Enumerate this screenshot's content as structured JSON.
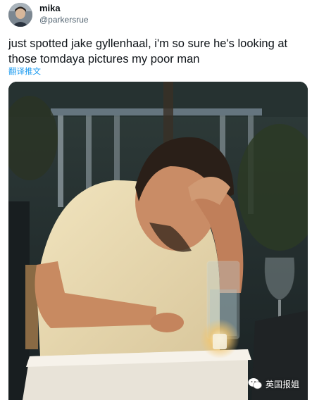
{
  "tweet": {
    "display_name": "mika",
    "handle": "@parkersrue",
    "text": "just spotted jake gyllenhaal, i'm so sure he's looking at those tomdaya pictures my poor man",
    "translate_label": "翻译推文"
  },
  "watermark": {
    "label": "英国报姐"
  },
  "colors": {
    "link": "#1d9bf0",
    "handle": "#536471",
    "text": "#0f1419"
  }
}
